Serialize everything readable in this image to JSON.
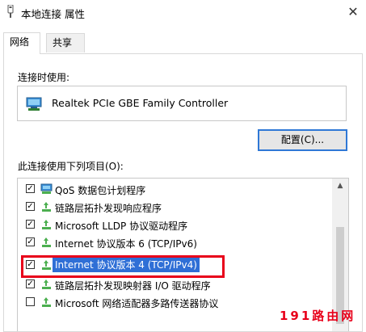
{
  "window": {
    "title": "本地连接 属性",
    "close_glyph": "✕"
  },
  "tabs": [
    {
      "label": "网络",
      "active": true
    },
    {
      "label": "共享",
      "active": false
    }
  ],
  "connect_using": {
    "label": "连接时使用:",
    "adapter_name": "Realtek PCIe GBE Family Controller"
  },
  "configure_button": "配置(C)...",
  "items_label": "此连接使用下列项目(O):",
  "items": [
    {
      "label": "QoS 数据包计划程序",
      "checked": true,
      "icon": "qos-icon"
    },
    {
      "label": "链路层拓扑发现响应程序",
      "checked": true,
      "icon": "network-protocol-icon"
    },
    {
      "label": "Microsoft LLDP 协议驱动程序",
      "checked": true,
      "icon": "network-protocol-icon"
    },
    {
      "label": "Internet 协议版本 6 (TCP/IPv6)",
      "checked": true,
      "icon": "network-protocol-icon"
    },
    {
      "label": "Internet 协议版本 4 (TCP/IPv4)",
      "checked": true,
      "icon": "network-protocol-icon",
      "selected": true
    },
    {
      "label": "链路层拓扑发现映射器 I/O 驱动程序",
      "checked": true,
      "icon": "network-protocol-icon"
    },
    {
      "label": "Microsoft 网络适配器多路传送器协议",
      "checked": false,
      "icon": "network-protocol-icon"
    }
  ],
  "check_glyph": "✓",
  "scroll_up_glyph": "▲",
  "watermark": "191路由网",
  "colors": {
    "selection": "#2f6fd6",
    "highlight_border": "#e8001a",
    "button_border": "#2f78d6",
    "watermark": "#e8001a"
  }
}
